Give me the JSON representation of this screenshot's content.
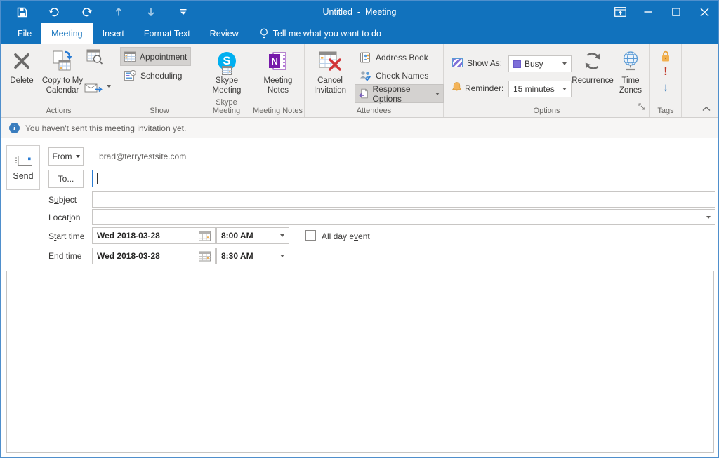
{
  "titlebar": {
    "title": "Untitled  -  Meeting"
  },
  "tabs": {
    "file": "File",
    "meeting": "Meeting",
    "insert": "Insert",
    "format_text": "Format Text",
    "review": "Review",
    "tell_me": "Tell me what you want to do"
  },
  "ribbon": {
    "actions": {
      "label": "Actions",
      "delete": "Delete",
      "copy_line1": "Copy to My",
      "copy_line2": "Calendar"
    },
    "show": {
      "label": "Show",
      "appointment": "Appointment",
      "scheduling": "Scheduling"
    },
    "skype": {
      "label": "Skype Meeting",
      "line1": "Skype",
      "line2": "Meeting"
    },
    "meeting_notes": {
      "label": "Meeting Notes",
      "line1": "Meeting",
      "line2": "Notes"
    },
    "attendees": {
      "label": "Attendees",
      "cancel_line1": "Cancel",
      "cancel_line2": "Invitation",
      "address_book": "Address Book",
      "check_names": "Check Names",
      "response_options": "Response Options"
    },
    "options": {
      "label": "Options",
      "show_as": "Show As:",
      "show_as_value": "Busy",
      "reminder": "Reminder:",
      "reminder_value": "15 minutes",
      "recurrence": "Recurrence",
      "tz_line1": "Time",
      "tz_line2": "Zones"
    },
    "tags": {
      "label": "Tags",
      "high_importance": "!",
      "low_importance": "↓"
    }
  },
  "infobar": {
    "message": "You haven't sent this meeting invitation yet."
  },
  "form": {
    "send": {
      "pre": "",
      "accel": "S",
      "post": "end"
    },
    "from_label": "From",
    "from_value": "brad@terrytestsite.com",
    "to_label": "To...",
    "subject": {
      "pre": "S",
      "accel": "u",
      "post": "bject"
    },
    "location": {
      "pre": "Locat",
      "accel": "i",
      "post": "on"
    },
    "start_time": {
      "pre": "S",
      "accel": "t",
      "post": "art time"
    },
    "end_time": {
      "pre": "En",
      "accel": "d",
      "post": " time"
    },
    "all_day": {
      "pre": "All day e",
      "accel": "v",
      "post": "ent"
    },
    "start_date": "Wed 2018-03-28",
    "start_clock": "8:00 AM",
    "end_date": "Wed 2018-03-28",
    "end_clock": "8:30 AM"
  },
  "colors": {
    "titlebar_blue": "#1172bd",
    "busy_purple": "#7e6fd9",
    "skype_blue": "#00aff0",
    "onenote_purple": "#7719aa",
    "selection_gray": "#d4d2d0",
    "focus_border_blue": "#2b7cd3"
  }
}
